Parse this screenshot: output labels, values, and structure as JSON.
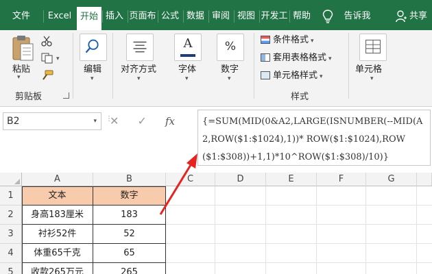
{
  "tabs": [
    {
      "label": "文件",
      "active": false
    },
    {
      "label": "Excel",
      "active": false
    },
    {
      "label": "开始",
      "active": true
    },
    {
      "label": "插入",
      "active": false
    },
    {
      "label": "页面布",
      "active": false
    },
    {
      "label": "公式",
      "active": false
    },
    {
      "label": "数据",
      "active": false
    },
    {
      "label": "审阅",
      "active": false
    },
    {
      "label": "视图",
      "active": false
    },
    {
      "label": "开发工",
      "active": false
    },
    {
      "label": "帮助",
      "active": false
    }
  ],
  "tellme": "告诉我",
  "share": "共享",
  "ribbon": {
    "clipboard": {
      "paste": "粘贴",
      "group": "剪贴板"
    },
    "edit": "编辑",
    "alignment": "对齐方式",
    "font": "字体",
    "number": "数字",
    "percent_symbol": "%",
    "font_glyph": "A",
    "styles": {
      "conditional": "条件格式",
      "table": "套用表格格式",
      "cell_style": "单元格样式",
      "group": "样式"
    },
    "cells": "单元格"
  },
  "formula_bar": {
    "name_box": "B2",
    "cancel": "✕",
    "enter": "✓",
    "fx": "fx",
    "formula": "{=SUM(MID(0&A2,LARGE(ISNUMBER(--MID(A2,ROW($1:$1024),1))* ROW($1:$1024),ROW($1:$308))+1,1)*10^ROW($1:$308)/10)}"
  },
  "sheet": {
    "columns": [
      "A",
      "B",
      "C",
      "D",
      "E",
      "F",
      "G"
    ],
    "rows": [
      "1",
      "2",
      "3",
      "4",
      "5"
    ],
    "data": [
      [
        "文本",
        "数字"
      ],
      [
        "身高183厘米",
        "183"
      ],
      [
        "衬衫52件",
        "52"
      ],
      [
        "体重65千克",
        "65"
      ],
      [
        "收款265万元",
        "265"
      ]
    ]
  },
  "colors": {
    "ribbon_green": "#217346",
    "header_fill": "#f8cbad",
    "arrow_red": "#e8221e"
  }
}
